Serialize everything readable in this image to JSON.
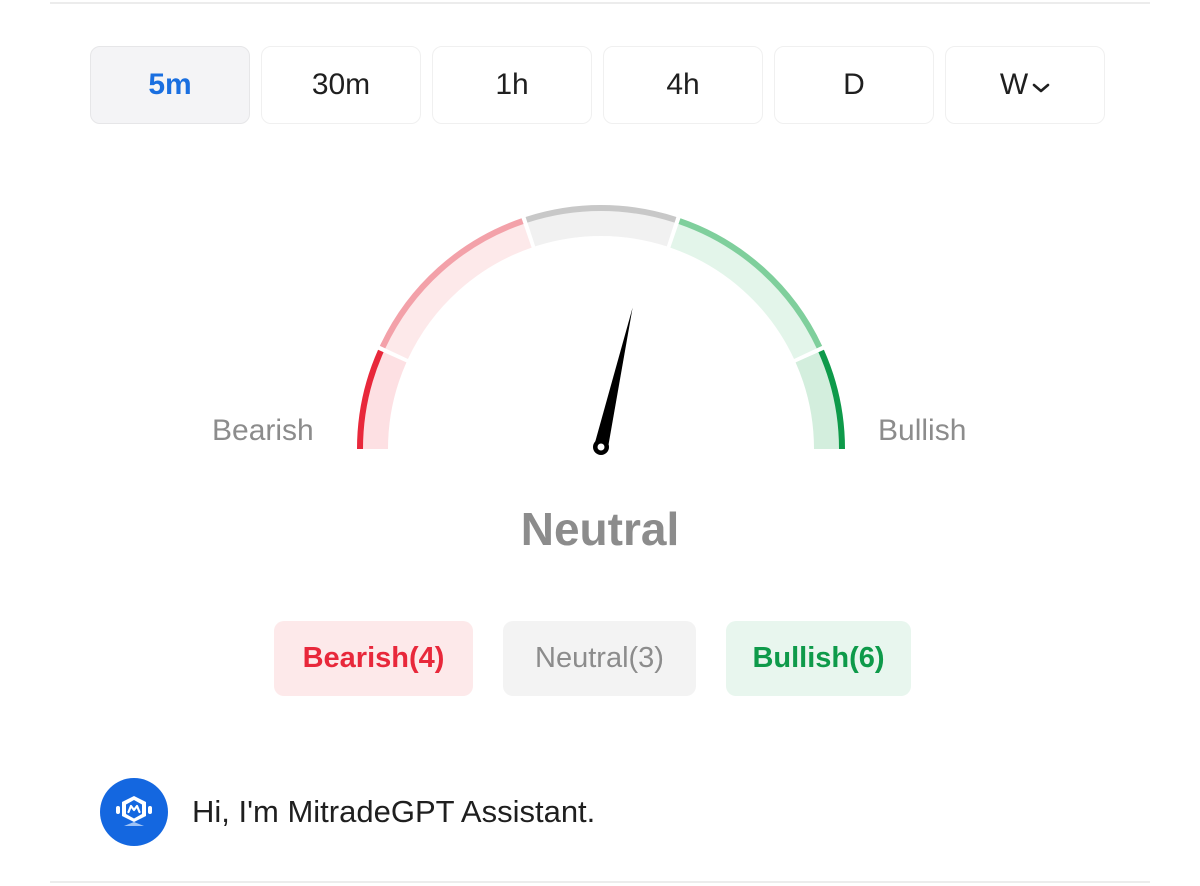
{
  "timeframes": {
    "items": [
      {
        "label": "5m",
        "active": true
      },
      {
        "label": "30m",
        "active": false
      },
      {
        "label": "1h",
        "active": false
      },
      {
        "label": "4h",
        "active": false
      },
      {
        "label": "D",
        "active": false
      },
      {
        "label": "W",
        "active": false
      }
    ],
    "dropdown_icon": "chevron-down-icon"
  },
  "gauge": {
    "left_label": "Bearish",
    "right_label": "Bullish",
    "reading": "Neutral",
    "needle_level": 0.57,
    "colors": {
      "bearish": "#e8283b",
      "neutral": "#c8c8c8",
      "bullish": "#0e9a4a"
    }
  },
  "counts": {
    "bearish": "Bearish(4)",
    "neutral": "Neutral(3)",
    "bullish": "Bullish(6)"
  },
  "assistant": {
    "icon": "assistant-logo-icon",
    "message": "Hi, I'm MitradeGPT Assistant."
  }
}
